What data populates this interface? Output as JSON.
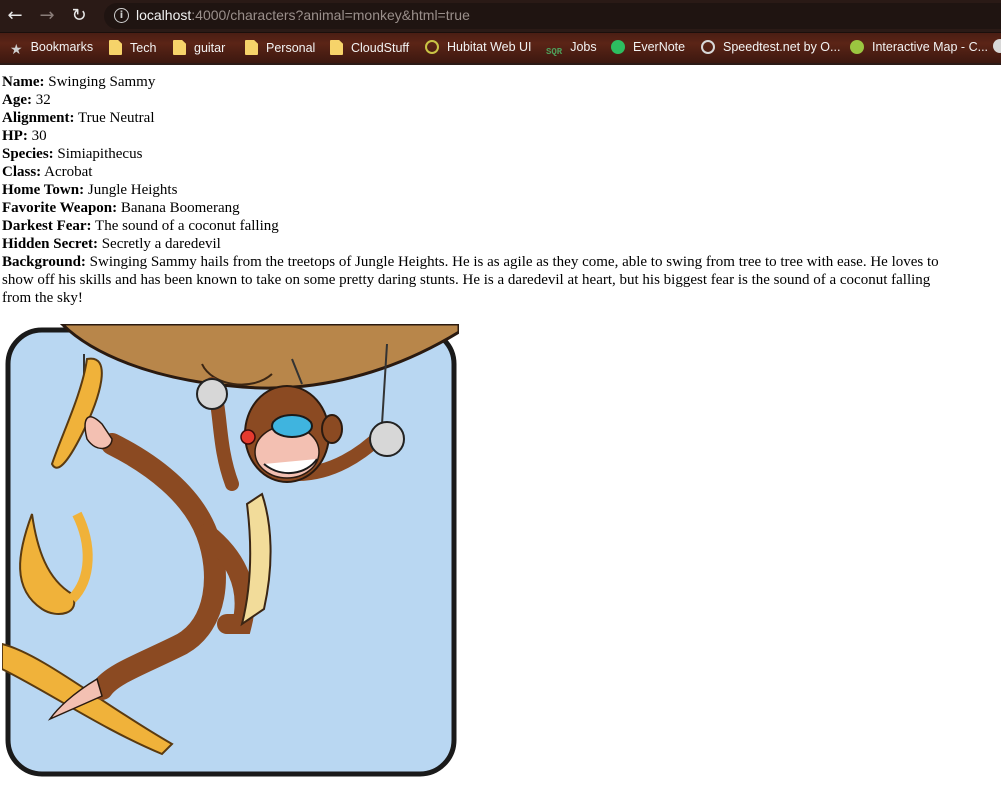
{
  "browser": {
    "url_host": "localhost",
    "url_rest": ":4000/characters?animal=monkey&html=true",
    "bookmarks": [
      {
        "label": "Bookmarks",
        "icon": "star-icon"
      },
      {
        "label": "Tech",
        "icon": "folder-icon"
      },
      {
        "label": "guitar",
        "icon": "folder-icon"
      },
      {
        "label": "Personal",
        "icon": "folder-icon"
      },
      {
        "label": "CloudStuff",
        "icon": "folder-icon"
      },
      {
        "label": "Hubitat Web UI",
        "icon": "hubitat-icon"
      },
      {
        "label": "Jobs",
        "icon": "sqr-icon"
      },
      {
        "label": "EverNote",
        "icon": "evernote-icon"
      },
      {
        "label": "Speedtest.net by O...",
        "icon": "speedtest-icon"
      },
      {
        "label": "Interactive Map - C...",
        "icon": "map-icon"
      }
    ]
  },
  "character": {
    "name_label": "Name:",
    "name": "Swinging Sammy",
    "age_label": "Age:",
    "age": "32",
    "alignment_label": "Alignment:",
    "alignment": "True Neutral",
    "hp_label": "HP:",
    "hp": "30",
    "species_label": "Species:",
    "species": "Simiapithecus",
    "class_label": "Class:",
    "class": "Acrobat",
    "hometown_label": "Home Town:",
    "hometown": "Jungle Heights",
    "weapon_label": "Favorite Weapon:",
    "weapon": "Banana Boomerang",
    "fear_label": "Darkest Fear:",
    "fear": "The sound of a coconut falling",
    "secret_label": "Hidden Secret:",
    "secret": "Secretly a daredevil",
    "background_label": "Background:",
    "background": "Swinging Sammy hails from the treetops of Jungle Heights. He is as agile as they come, able to swing from tree to tree with ease. He loves to show off his skills and has been known to take on some pretty daring stunts. He is a daredevil at heart, but his biggest fear is the sound of a coconut falling from the sky!"
  },
  "colors": {
    "chrome_dark": "#2a1a16",
    "bookmarks_bar": "#5b2416",
    "art_sky": "#b9d7f2",
    "monkey_brown": "#8b4a22",
    "banana_yellow": "#f0b23a"
  }
}
